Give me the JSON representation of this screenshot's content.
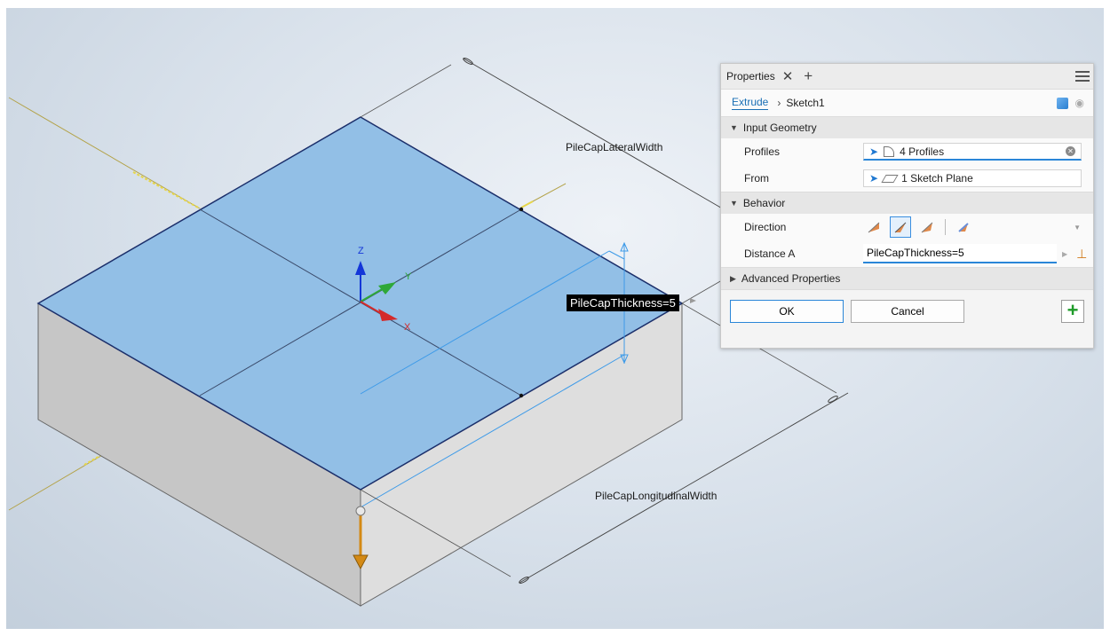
{
  "viewport": {
    "dimensions": {
      "lateral": "PileCapLateralWidth",
      "longitudinal": "PileCapLongitudinalWidth",
      "thickness": "PileCapThickness=5"
    },
    "axes": {
      "z": "Z",
      "y": "Y",
      "x": "X"
    }
  },
  "panel": {
    "tab_label": "Properties",
    "breadcrumb": {
      "feature": "Extrude",
      "sketch": "Sketch1"
    },
    "sections": {
      "input_geometry": "Input Geometry",
      "behavior": "Behavior",
      "advanced": "Advanced Properties"
    },
    "rows": {
      "profiles_label": "Profiles",
      "profiles_value": "4 Profiles",
      "from_label": "From",
      "from_value": "1 Sketch Plane",
      "direction_label": "Direction",
      "distance_label": "Distance A",
      "distance_value": "PileCapThickness=5"
    },
    "buttons": {
      "ok": "OK",
      "cancel": "Cancel"
    }
  }
}
